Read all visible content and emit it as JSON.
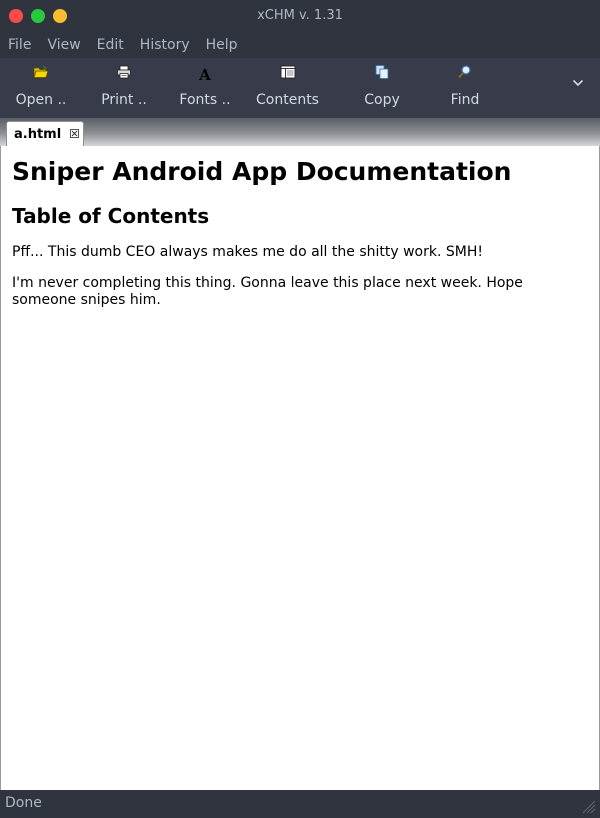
{
  "window": {
    "title": "xCHM v. 1.31"
  },
  "menu": {
    "items": [
      "File",
      "View",
      "Edit",
      "History",
      "Help"
    ]
  },
  "toolbar": {
    "open_label": "Open ..",
    "print_label": "Print ..",
    "fonts_label": "Fonts ..",
    "contents_label": "Contents",
    "copy_label": "Copy",
    "find_label": "Find",
    "fonts_icon_glyph": "A"
  },
  "tabs": [
    {
      "label": "a.html",
      "active": true
    }
  ],
  "document": {
    "heading1": "Sniper Android App Documentation",
    "heading2": "Table of Contents",
    "paragraphs": [
      "Pff... This dumb CEO always makes me do all the shitty work. SMH!",
      "I'm never completing this thing. Gonna leave this place next week. Hope someone snipes him."
    ]
  },
  "status": {
    "text": "Done"
  },
  "colors": {
    "window_bg": "#2f343f",
    "toolbar_bg": "#383c4a",
    "close": "#fc4b4b",
    "minimize": "#27c93f",
    "maximize": "#fdbc2f",
    "content_bg": "#ffffff"
  },
  "icons": {
    "open": "folder-open-icon",
    "print": "printer-icon",
    "fonts": "font-icon",
    "contents": "contents-icon",
    "copy": "copy-icon",
    "find": "magnifier-icon",
    "overflow": "chevron-down-icon"
  }
}
